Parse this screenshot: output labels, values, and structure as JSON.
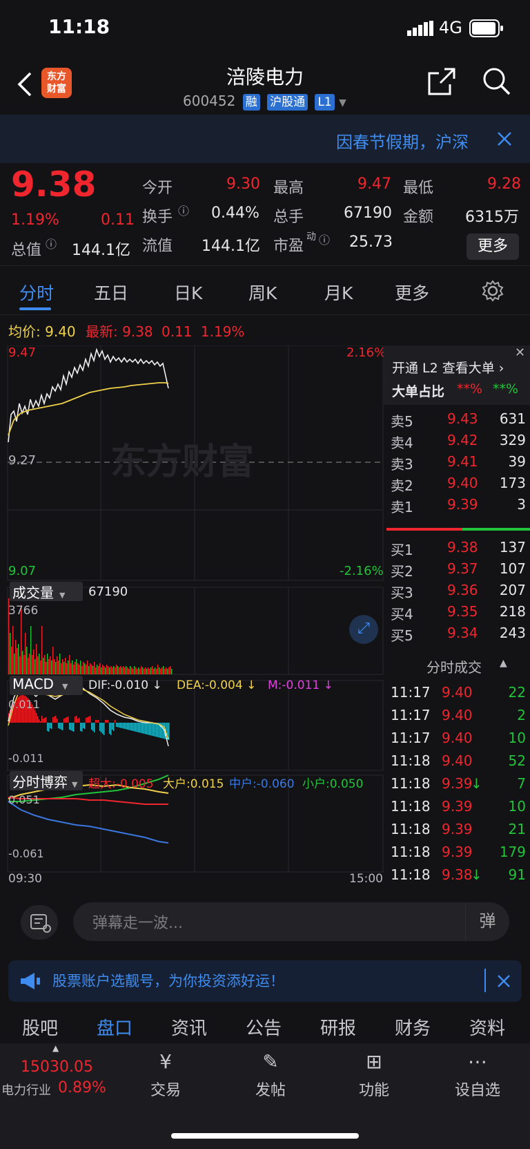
{
  "status": {
    "time": "11:18",
    "network": "4G"
  },
  "header": {
    "title": "涪陵电力",
    "code": "600452",
    "tags": [
      "融",
      "沪股通",
      "L1"
    ],
    "logo_text_1": "东方",
    "logo_text_2": "财富"
  },
  "notice": {
    "text": "因春节假期，沪深"
  },
  "quote": {
    "price": "9.38",
    "pct": "1.19%",
    "change": "0.11",
    "open_label": "今开",
    "open": "9.30",
    "high_label": "最高",
    "high": "9.47",
    "low_label": "最低",
    "low": "9.28",
    "turnover_label": "换手",
    "turnover": "0.44%",
    "volume_label": "总手",
    "volume": "67190",
    "amount_label": "金额",
    "amount": "6315万",
    "mcap_label": "总值",
    "mcap": "144.1亿",
    "float_label": "流值",
    "float": "144.1亿",
    "pe_label": "市盈",
    "pe_sup": "动",
    "pe": "25.73",
    "more": "更多"
  },
  "tabs": [
    "分时",
    "五日",
    "日K",
    "周K",
    "月K",
    "更多"
  ],
  "summary": {
    "avg_label": "均价:",
    "avg": "9.40",
    "last_label": "最新:",
    "last": "9.38",
    "chg": "0.11",
    "pct": "1.19%"
  },
  "chart_labels": {
    "price_top": "9.47",
    "price_mid": "9.27",
    "price_bot": "9.07",
    "pct_top": "2.16%",
    "pct_bot": "-2.16%",
    "watermark": "东方财富",
    "vol_title": "成交量",
    "vol_total": "67190",
    "vol_max": "3766",
    "macd_title": "MACD",
    "dif": "DIF:-0.010 ↓",
    "dea": "DEA:-0.004 ↓",
    "m": "M:-0.011 ↓",
    "macd_top": "0.011",
    "macd_bot": "-0.011",
    "game_title": "分时博弈",
    "super": "超大:-0.005",
    "big": "大户:0.015",
    "mid": "中户:-0.060",
    "small": "小户:0.050",
    "game_top": "0.051",
    "game_bot": "-0.061",
    "time_start": "09:30",
    "time_end": "15:00"
  },
  "orderbook": {
    "l2_text": "开通 L2 查看大单 ›",
    "big_ratio_label": "大单占比",
    "big_red": "**%",
    "big_green": "**%",
    "asks": [
      {
        "label": "卖5",
        "price": "9.43",
        "vol": "631"
      },
      {
        "label": "卖4",
        "price": "9.42",
        "vol": "329"
      },
      {
        "label": "卖3",
        "price": "9.41",
        "vol": "39"
      },
      {
        "label": "卖2",
        "price": "9.40",
        "vol": "173"
      },
      {
        "label": "卖1",
        "price": "9.39",
        "vol": "3"
      }
    ],
    "bids": [
      {
        "label": "买1",
        "price": "9.38",
        "vol": "137"
      },
      {
        "label": "买2",
        "price": "9.37",
        "vol": "107"
      },
      {
        "label": "买3",
        "price": "9.36",
        "vol": "207"
      },
      {
        "label": "买4",
        "price": "9.35",
        "vol": "218"
      },
      {
        "label": "买5",
        "price": "9.34",
        "vol": "243"
      }
    ],
    "ticks_title": "分时成交",
    "ticks": [
      {
        "time": "11:17",
        "price": "9.40",
        "vol": "22",
        "dir": ""
      },
      {
        "time": "11:17",
        "price": "9.40",
        "vol": "2",
        "dir": ""
      },
      {
        "time": "11:17",
        "price": "9.40",
        "vol": "10",
        "dir": ""
      },
      {
        "time": "11:18",
        "price": "9.40",
        "vol": "52",
        "dir": ""
      },
      {
        "time": "11:18",
        "price": "9.39",
        "vol": "7",
        "dir": "↓"
      },
      {
        "time": "11:18",
        "price": "9.39",
        "vol": "10",
        "dir": ""
      },
      {
        "time": "11:18",
        "price": "9.39",
        "vol": "21",
        "dir": ""
      },
      {
        "time": "11:18",
        "price": "9.39",
        "vol": "179",
        "dir": ""
      },
      {
        "time": "11:18",
        "price": "9.38",
        "vol": "91",
        "dir": "↓"
      }
    ]
  },
  "danmu": {
    "placeholder": "弹幕走一波...",
    "btn": "弹"
  },
  "notice2": {
    "text": "股票账户选靓号，为你投资添好运！"
  },
  "bottom_tabs": [
    "股吧",
    "盘口",
    "资讯",
    "公告",
    "研报",
    "财务",
    "资料"
  ],
  "dock": {
    "index_value": "15030.05",
    "index_name": "电力行业",
    "index_pct": "0.89%",
    "items": [
      "交易",
      "发帖",
      "功能",
      "设自选"
    ]
  },
  "colors": {
    "up": "#f0262e",
    "down": "#22c43a",
    "accent": "#3f8cf0",
    "avg_line": "#f0d24a"
  }
}
